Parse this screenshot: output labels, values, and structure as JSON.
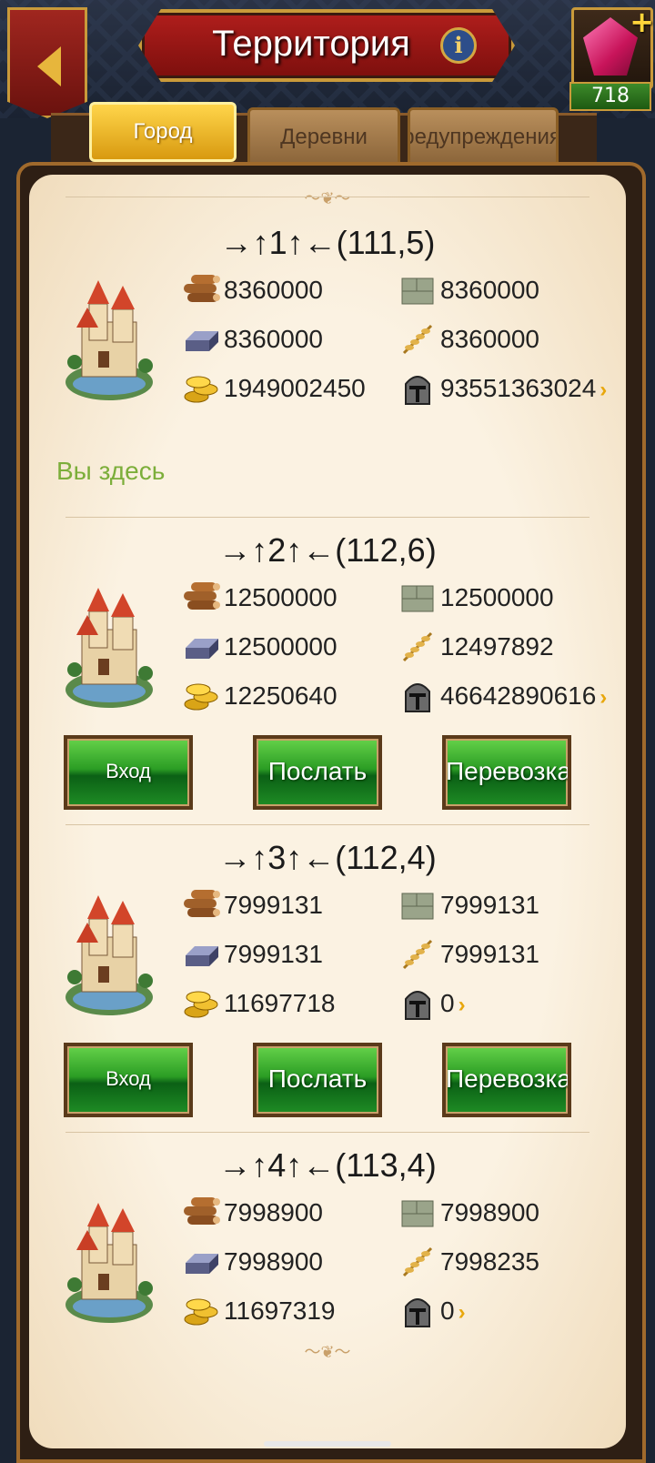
{
  "header": {
    "title": "Территория",
    "gems": "718"
  },
  "tabs": [
    {
      "label": "Город",
      "active": true
    },
    {
      "label": "Деревни",
      "active": false
    },
    {
      "label": "Предупреждения",
      "active": false
    }
  ],
  "you_here": "Вы здесь",
  "cities": [
    {
      "coord": "→↑1↑←(111,5)",
      "wood": "8360000",
      "stone": "8360000",
      "iron": "8360000",
      "grain": "8360000",
      "gold": "1949002450",
      "army": "93551363024",
      "buttons": null
    },
    {
      "coord": "→↑2↑←(112,6)",
      "wood": "12500000",
      "stone": "12500000",
      "iron": "12500000",
      "grain": "12497892",
      "gold": "12250640",
      "army": "46642890616",
      "buttons": {
        "enter": "Вход",
        "send": "Послать",
        "transport": "Перевозка"
      }
    },
    {
      "coord": "→↑3↑←(112,4)",
      "wood": "7999131",
      "stone": "7999131",
      "iron": "7999131",
      "grain": "7999131",
      "gold": "11697718",
      "army": "0",
      "buttons": {
        "enter": "Вход",
        "send": "Послать",
        "transport": "Перевозка"
      }
    },
    {
      "coord": "→↑4↑←(113,4)",
      "wood": "7998900",
      "stone": "7998900",
      "iron": "7998900",
      "grain": "7998235",
      "gold": "11697319",
      "army": "0",
      "buttons": null
    }
  ]
}
